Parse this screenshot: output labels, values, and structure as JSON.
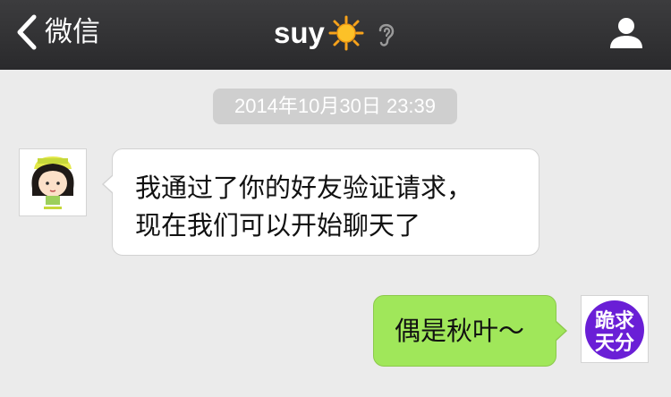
{
  "nav": {
    "back_label": "微信",
    "back_icon": "chevron-left-icon",
    "title": "suy",
    "title_emoji_icon": "sun-icon",
    "mode_icon": "ear-icon",
    "profile_icon": "person-icon"
  },
  "timestamp": "2014年10月30日 23:39",
  "messages": [
    {
      "direction": "incoming",
      "avatar_icon": "cartoon-girl-avatar",
      "lines": [
        "我通过了你的好友验证请求，",
        "现在我们可以开始聊天了"
      ]
    },
    {
      "direction": "outgoing",
      "avatar_icon": "purple-badge-avatar",
      "avatar_text": "跪求天分",
      "text": "偶是秋叶～"
    }
  ],
  "colors": {
    "navbar": "#2f2f31",
    "background": "#ebebeb",
    "bubble_incoming": "#ffffff",
    "bubble_outgoing": "#a0e75a",
    "timestamp_bg": "#cfcfcf",
    "avatar_badge": "#6a1fd6"
  }
}
